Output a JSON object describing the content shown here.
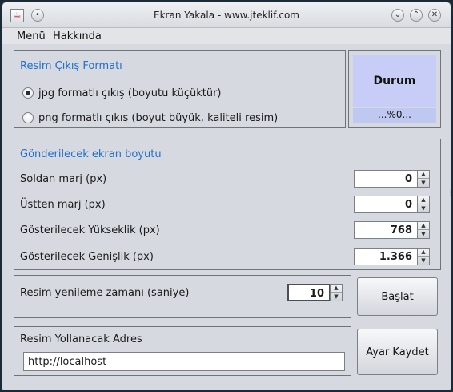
{
  "window": {
    "title": "Ekran Yakala - www.jteklif.com"
  },
  "menubar": {
    "items": [
      "Menü",
      "Hakkında"
    ]
  },
  "format_panel": {
    "title": "Resim Çıkış Formatı",
    "options": [
      {
        "label": "jpg formatlı çıkış (boyutu küçüktür)",
        "checked": true
      },
      {
        "label": "png formatlı çıkış (boyut büyük, kaliteli resim)",
        "checked": false
      }
    ]
  },
  "status": {
    "title": "Durum",
    "progress_text": "...%0..."
  },
  "size_panel": {
    "title": "Gönderilecek ekran boyutu",
    "rows": [
      {
        "label": "Soldan marj (px)",
        "value": "0"
      },
      {
        "label": "Üstten marj (px)",
        "value": "0"
      },
      {
        "label": "Gösterilecek Yükseklik (px)",
        "value": "768"
      },
      {
        "label": "Gösterilecek Genişlik (px)",
        "value": "1.366"
      }
    ]
  },
  "refresh_panel": {
    "label": "Resim yenileme zamanı (saniye)",
    "value": "10"
  },
  "address_panel": {
    "title": "Resim Yollanacak Adres",
    "value": "http://localhost"
  },
  "buttons": {
    "start": "Başlat",
    "save_settings": "Ayar Kaydet"
  },
  "colors": {
    "panel_title": "#1f6fd0",
    "status_bg": "#c7cdf7",
    "window_bg": "#d6d9df"
  },
  "icons": {
    "app": "java-cup-icon",
    "pin": "pin-icon",
    "minimize": "minimize-icon",
    "maximize": "maximize-icon",
    "close": "close-icon",
    "spin_up": "arrow-up-icon",
    "spin_down": "arrow-down-icon"
  }
}
